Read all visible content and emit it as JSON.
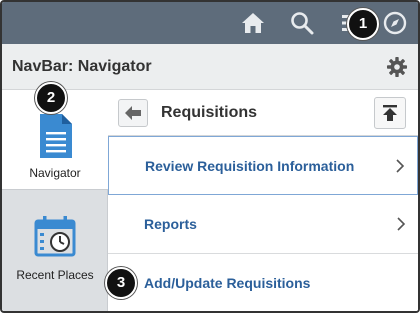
{
  "header": {
    "title": "NavBar: Navigator"
  },
  "topbar": {
    "icons": [
      "home-icon",
      "search-icon",
      "menu-icon",
      "compass-icon"
    ]
  },
  "sidebar": {
    "items": [
      {
        "label": "Navigator",
        "icon": "document-icon",
        "selected": true
      },
      {
        "label": "Recent Places",
        "icon": "calendar-clock-icon",
        "selected": false
      }
    ]
  },
  "content": {
    "title": "Requisitions",
    "rows": [
      {
        "label": "Review Requisition Information",
        "has_chevron": true,
        "focused": true
      },
      {
        "label": "Reports",
        "has_chevron": true,
        "focused": false
      },
      {
        "label": "Add/Update Requisitions",
        "has_chevron": false,
        "focused": false
      }
    ]
  },
  "steps": [
    "1",
    "2",
    "3"
  ],
  "colors": {
    "topbar": "#5e6c7b",
    "link": "#2b5f9a",
    "icon_blue": "#3a8ad1"
  }
}
